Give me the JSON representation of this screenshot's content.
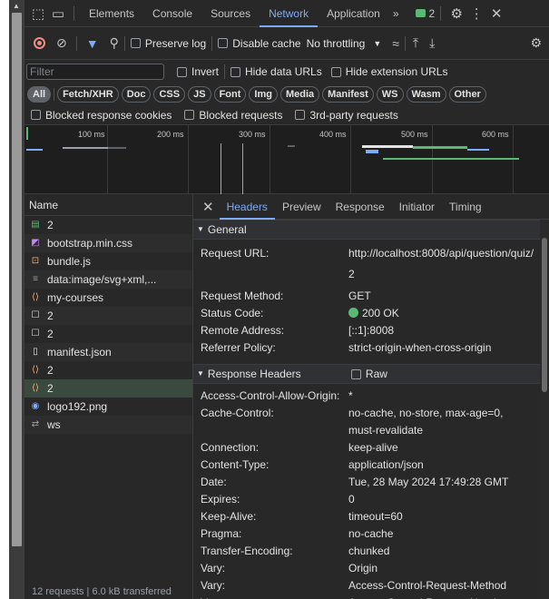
{
  "devtools": {
    "tabs": [
      "Elements",
      "Console",
      "Sources",
      "Network",
      "Application"
    ],
    "active_tab": "Network",
    "more_tabs": "»",
    "issues_count": "2"
  },
  "network_toolbar": {
    "preserve_log": "Preserve log",
    "disable_cache": "Disable cache",
    "throttling": "No throttling"
  },
  "filter": {
    "placeholder": "Filter",
    "invert": "Invert",
    "hide_data_urls": "Hide data URLs",
    "hide_extension_urls": "Hide extension URLs"
  },
  "types": [
    "All",
    "Fetch/XHR",
    "Doc",
    "CSS",
    "JS",
    "Font",
    "Img",
    "Media",
    "Manifest",
    "WS",
    "Wasm",
    "Other"
  ],
  "blocked": {
    "cookies": "Blocked response cookies",
    "requests": "Blocked requests",
    "third_party": "3rd-party requests"
  },
  "overview": {
    "ticks": [
      "100 ms",
      "200 ms",
      "300 ms",
      "400 ms",
      "500 ms",
      "600 ms"
    ]
  },
  "requests": {
    "header": "Name",
    "items": [
      {
        "name": "2",
        "icon": "document-icon",
        "color": "#5bb974"
      },
      {
        "name": "bootstrap.min.css",
        "icon": "css-icon",
        "color": "#c58af9"
      },
      {
        "name": "bundle.js",
        "icon": "js-icon",
        "color": "#fcad70"
      },
      {
        "name": "data:image/svg+xml,...",
        "icon": "image-data-icon",
        "color": "#9aa0a6"
      },
      {
        "name": "my-courses",
        "icon": "fetch-icon",
        "color": "#fcad70"
      },
      {
        "name": "2",
        "icon": "checkbox-icon",
        "color": "#e3e3e3"
      },
      {
        "name": "2",
        "icon": "checkbox-icon",
        "color": "#e3e3e3"
      },
      {
        "name": "manifest.json",
        "icon": "manifest-icon",
        "color": "#e3e3e3"
      },
      {
        "name": "2",
        "icon": "fetch-icon",
        "color": "#fcad70"
      },
      {
        "name": "2",
        "icon": "fetch-icon",
        "color": "#fcad70"
      },
      {
        "name": "logo192.png",
        "icon": "image-icon",
        "color": "#7cacf8"
      },
      {
        "name": "ws",
        "icon": "websocket-icon",
        "color": "#9aa0a6"
      }
    ],
    "status_text": "12 requests | 6.0 kB transferred"
  },
  "detail_tabs": [
    "Headers",
    "Preview",
    "Response",
    "Initiator",
    "Timing"
  ],
  "active_detail_tab": "Headers",
  "general": {
    "title": "General",
    "request_url_key": "Request URL:",
    "request_url_line1": "http://localhost:8008/api/question/quiz/",
    "request_url_line2": "2",
    "method_key": "Request Method:",
    "method": "GET",
    "status_key": "Status Code:",
    "status": "200 OK",
    "remote_key": "Remote Address:",
    "remote": "[::1]:8008",
    "referrer_key": "Referrer Policy:",
    "referrer": "strict-origin-when-cross-origin"
  },
  "response_headers": {
    "title": "Response Headers",
    "raw_label": "Raw",
    "rows": [
      {
        "k": "Access-Control-Allow-Origin:",
        "v": "*"
      },
      {
        "k": "Cache-Control:",
        "v": "no-cache, no-store, max-age=0,"
      },
      {
        "k": "",
        "v": "must-revalidate"
      },
      {
        "k": "Connection:",
        "v": "keep-alive"
      },
      {
        "k": "Content-Type:",
        "v": "application/json"
      },
      {
        "k": "Date:",
        "v": "Tue, 28 May 2024 17:49:28 GMT"
      },
      {
        "k": "Expires:",
        "v": "0"
      },
      {
        "k": "Keep-Alive:",
        "v": "timeout=60"
      },
      {
        "k": "Pragma:",
        "v": "no-cache"
      },
      {
        "k": "Transfer-Encoding:",
        "v": "chunked"
      },
      {
        "k": "Vary:",
        "v": "Origin"
      },
      {
        "k": "Vary:",
        "v": "Access-Control-Request-Method"
      },
      {
        "k": "Vary:",
        "v": "Access-Control-Request-Headers"
      }
    ]
  },
  "colors": {
    "accent": "#7cacf8",
    "record": "#f28b82",
    "ok": "#5bb974"
  }
}
